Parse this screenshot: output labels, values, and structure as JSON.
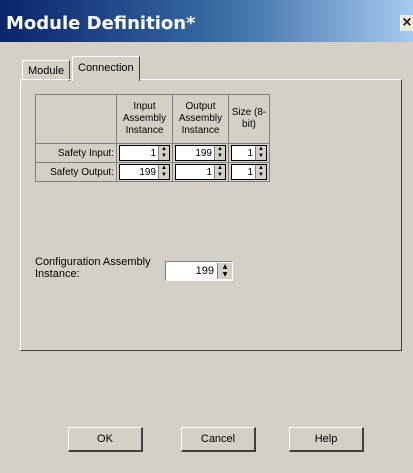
{
  "window": {
    "title": "Module Definition*",
    "close_glyph": "×"
  },
  "tabs": [
    {
      "label": "Module"
    },
    {
      "label": "Connection"
    }
  ],
  "table": {
    "headers": [
      "Input Assembly Instance",
      "Output Assembly Instance",
      "Size (8-bit)"
    ],
    "rows": [
      {
        "label": "Safety Input:",
        "input_instance": "1",
        "output_instance": "199",
        "size": "1"
      },
      {
        "label": "Safety Output:",
        "input_instance": "199",
        "output_instance": "1",
        "size": "1"
      }
    ]
  },
  "configuration": {
    "label": "Configuration Assembly Instance:",
    "value": "199"
  },
  "buttons": {
    "ok": "OK",
    "cancel": "Cancel",
    "help": "Help"
  },
  "colors": {
    "dialog_bg": "#d4d0c8",
    "title_start": "#0a246a",
    "title_end": "#a6caf0"
  }
}
